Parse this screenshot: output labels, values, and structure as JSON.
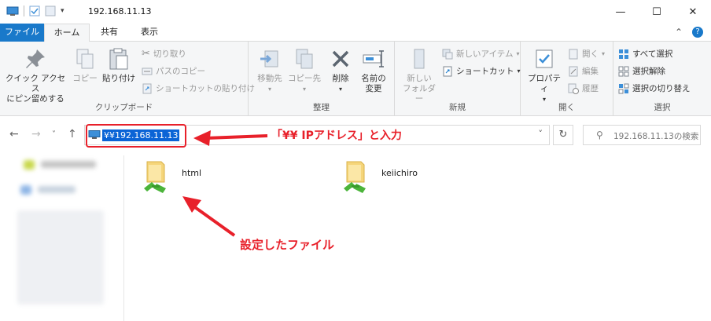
{
  "window": {
    "title": "192.168.11.13",
    "minimize": "—",
    "maximize": "☐",
    "close": "✕"
  },
  "tabs": {
    "file": "ファイル",
    "home": "ホーム",
    "share": "共有",
    "view": "表示"
  },
  "ribbon": {
    "clipboard": {
      "label": "クリップボード",
      "pin_quick": [
        "クイック アクセス",
        "にピン留めする"
      ],
      "copy": "コピー",
      "paste": "貼り付け",
      "cut": "切り取り",
      "copy_path": "パスのコピー",
      "paste_shortcut": "ショートカットの貼り付け"
    },
    "organize": {
      "label": "整理",
      "move_to": "移動先",
      "copy_to": "コピー先",
      "delete": "削除",
      "rename": [
        "名前の",
        "変更"
      ]
    },
    "new": {
      "label": "新規",
      "new_folder": [
        "新しい",
        "フォルダー"
      ],
      "new_item": "新しいアイテム",
      "shortcut": "ショートカット"
    },
    "open": {
      "label": "開く",
      "properties": "プロパティ",
      "open": "開く",
      "edit": "編集",
      "history": "履歴"
    },
    "select": {
      "label": "選択",
      "select_all": "すべて選択",
      "select_none": "選択解除",
      "invert": "選択の切り替え"
    }
  },
  "address": {
    "value": "¥¥192.168.11.13",
    "search_placeholder": "192.168.11.13の検索"
  },
  "annotations": {
    "top": "「¥¥ IPアドレス」と入力",
    "bottom": "設定したファイル",
    "color": "#e8202a"
  },
  "items": [
    {
      "name": "html"
    },
    {
      "name": "keiichiro"
    }
  ]
}
